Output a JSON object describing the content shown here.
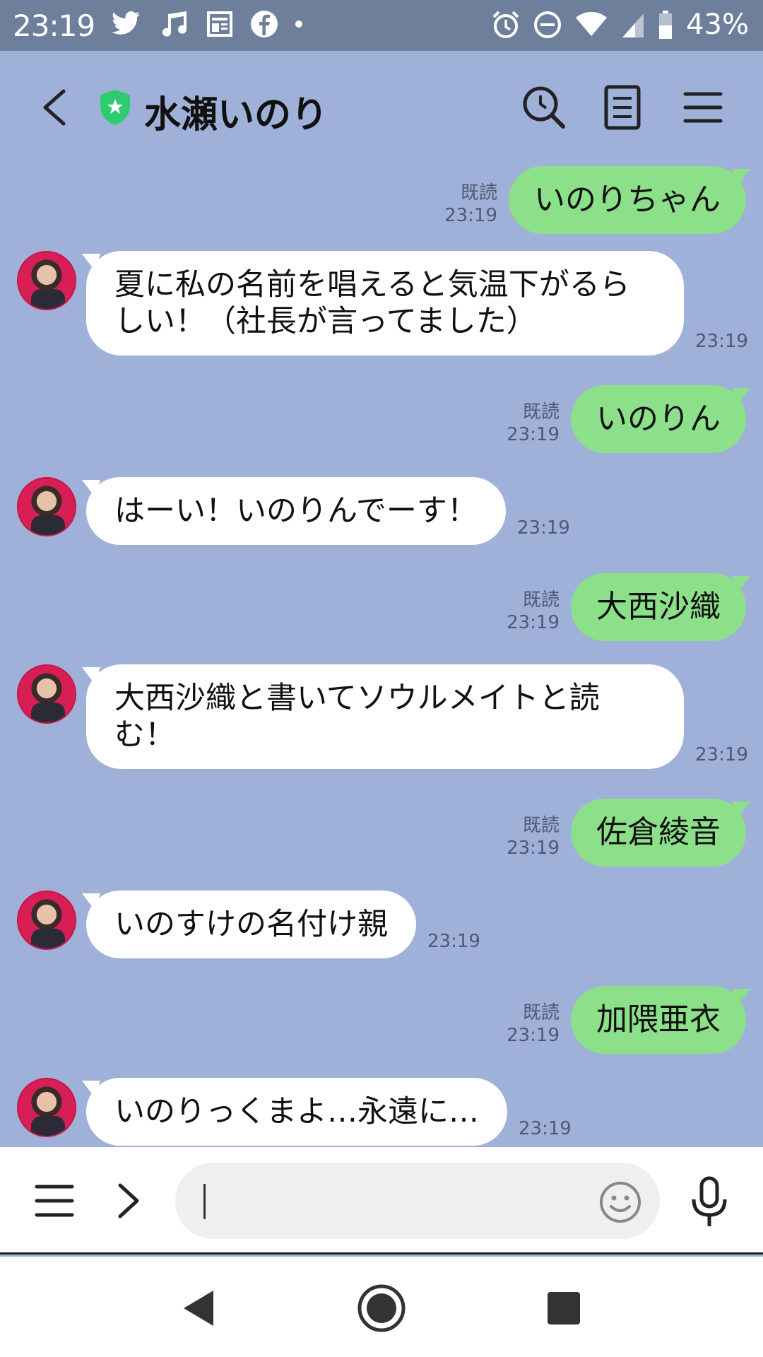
{
  "status_bar": {
    "time": "23:19",
    "battery": "43%",
    "left_icons": [
      "twitter-icon",
      "music-note-icon",
      "news-icon",
      "facebook-icon",
      "dot-icon"
    ],
    "right_icons": [
      "alarm-icon",
      "do-not-disturb-icon",
      "wifi-icon",
      "signal-icon",
      "battery-icon"
    ]
  },
  "header": {
    "title": "水瀬いのり",
    "icons": [
      "back-icon",
      "official-shield-icon",
      "search-icon",
      "notes-icon",
      "menu-icon"
    ]
  },
  "messages": [
    {
      "dir": "out",
      "text": "いのりちゃん",
      "read": "既読",
      "time": "23:19"
    },
    {
      "dir": "in",
      "text": "夏に私の名前を唱えると気温下がるらしい！（社長が言ってました）",
      "time": "23:19"
    },
    {
      "dir": "out",
      "text": "いのりん",
      "read": "既読",
      "time": "23:19"
    },
    {
      "dir": "in",
      "text": "はーい！いのりんでーす！",
      "time": "23:19"
    },
    {
      "dir": "out",
      "text": "大西沙織",
      "read": "既読",
      "time": "23:19"
    },
    {
      "dir": "in",
      "text": "大西沙織と書いてソウルメイトと読む！",
      "time": "23:19"
    },
    {
      "dir": "out",
      "text": "佐倉綾音",
      "read": "既読",
      "time": "23:19"
    },
    {
      "dir": "in",
      "text": "いのすけの名付け親",
      "time": "23:19"
    },
    {
      "dir": "out",
      "text": "加隈亜衣",
      "read": "既読",
      "time": "23:19"
    },
    {
      "dir": "in",
      "text": "いのりっくまよ…永遠に…",
      "time": "23:19"
    }
  ],
  "input": {
    "value": "",
    "icons": [
      "menu-icon",
      "chevron-right-icon",
      "emoji-icon",
      "microphone-icon"
    ]
  },
  "nav": {
    "icons": [
      "back-triangle-icon",
      "home-circle-icon",
      "recents-square-icon"
    ]
  },
  "colors": {
    "chat_bg": "#9fb1d8",
    "outgoing_bubble": "#8de08a",
    "incoming_bubble": "#ffffff",
    "status_bar": "#6e7f9b",
    "shield": "#2ecc71"
  }
}
